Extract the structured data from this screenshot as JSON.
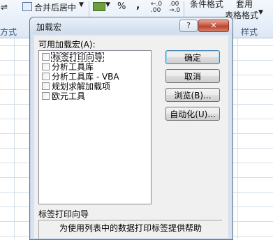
{
  "ribbon": {
    "merge_center": "合并后居中",
    "percent": "%",
    "comma": ",",
    "dec_increase": "←.0\n.00",
    "dec_decrease": ".00\n→.0",
    "cond_format": "条件格式",
    "table_format_top": "套用",
    "table_format": "表格格式",
    "styles_group": "样式",
    "align_group": "方式"
  },
  "dialog": {
    "title": "加载宏",
    "help_label": "?",
    "close_label": "✕",
    "list_label": "可用加载宏(A):",
    "addins": [
      {
        "label": "标签打印向导",
        "checked": false
      },
      {
        "label": "分析工具库",
        "checked": false
      },
      {
        "label": "分析工具库 - VBA",
        "checked": false
      },
      {
        "label": "规划求解加载项",
        "checked": false
      },
      {
        "label": "欧元工具",
        "checked": false
      }
    ],
    "buttons": {
      "ok": "确定",
      "cancel": "取消",
      "browse": "浏览(B)...",
      "automation": "自动化(U)..."
    },
    "description_title": "标签打印向导",
    "description_text": "为使用列表中的数据打印标签提供帮助"
  }
}
